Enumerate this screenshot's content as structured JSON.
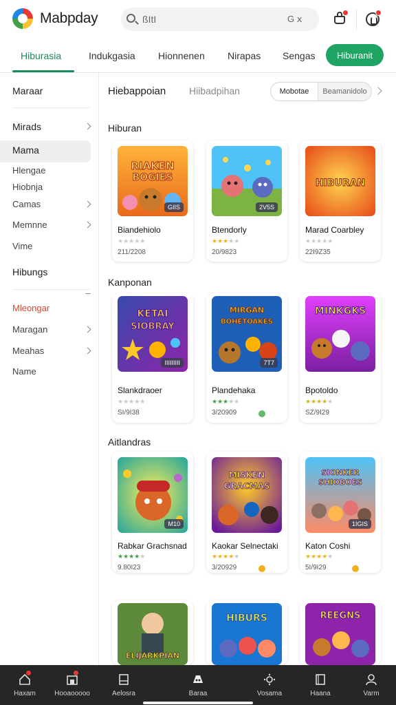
{
  "app": {
    "title": "Mabpday",
    "search_text": "ßItI",
    "search_shortcut": "G ⅹ"
  },
  "tabs": {
    "items": [
      "Hiburasia",
      "Indukgasia",
      "Hionnenen",
      "Nirapas",
      "Sengas"
    ],
    "active": "Hiburasia",
    "cta": "Hiburanit"
  },
  "sidebar": {
    "items": [
      "Maraar",
      "Mirads",
      "Mama",
      "Hlengae",
      "Hiobnja",
      "Camas",
      "Memnne",
      "Vime",
      "Hibungs",
      "Mleongar",
      "Maragan",
      "Meahas",
      "Name"
    ]
  },
  "main": {
    "title": "Hiebappoian",
    "subtitle": "Hiibadpihan",
    "segment_a": "Mobotae",
    "segment_b": "Beamanidolo"
  },
  "sections": [
    {
      "title": "Hiburan",
      "cards": [
        {
          "thumb_text": "RIAKEN BOGIES",
          "tag": "GIIS",
          "name": "Biandehiolo",
          "meta": "211/2208",
          "stars_color": "#c9c9c9"
        },
        {
          "thumb_text": "",
          "tag": "2V5S",
          "name": "Btendorly",
          "meta": "20/9823",
          "stars_color": "#f2b01e"
        },
        {
          "thumb_text": "HIBURAN",
          "tag": "",
          "name": "Marad Coarbley",
          "meta": "22I9Z35",
          "stars_color": "#c9c9c9"
        }
      ]
    },
    {
      "title": "Kanponan",
      "cards": [
        {
          "thumb_text": "KETAI SIOBRAY",
          "tag": "IIIIIIIII",
          "name": "Slankdraoer",
          "meta": "SI/9I38",
          "stars_color": "#c9c9c9"
        },
        {
          "thumb_text": "MIRGAN BOHETOAKES",
          "tag": "7T7",
          "name": "Plandehaka",
          "meta": "3/20909",
          "stars_color": "#43a047"
        },
        {
          "thumb_text": "MINKGKS",
          "tag": "",
          "name": "Bpotoldo",
          "meta": "SZ/9I29",
          "stars_color": "#d6b21c"
        }
      ]
    },
    {
      "title": "Aitlandras",
      "cards": [
        {
          "thumb_text": "",
          "tag": "M10",
          "name": "Rabkar Grachsnad",
          "meta": "9.80I23",
          "stars_color": "#43a047"
        },
        {
          "thumb_text": "MISKEN GRACMAS",
          "tag": "",
          "name": "Kaokar Selnectaki",
          "meta": "3/20929",
          "stars_color": "#f2b01e"
        },
        {
          "thumb_text": "SIONKER SHIOBOES",
          "tag": "1IGIS",
          "name": "Katon Coshi",
          "meta": "5I/9I29",
          "stars_color": "#f2b01e"
        }
      ]
    },
    {
      "title": "",
      "cards": [
        {
          "thumb_text": "ELIJARKPIAN",
          "tag": "",
          "name": "",
          "meta": "",
          "stars_color": ""
        },
        {
          "thumb_text": "HIBURS",
          "tag": "",
          "name": "",
          "meta": "",
          "stars_color": ""
        },
        {
          "thumb_text": "REEGNS",
          "tag": "",
          "name": "",
          "meta": "",
          "stars_color": ""
        }
      ]
    }
  ],
  "bottom_nav": {
    "items": [
      "Haxam",
      "Hooaooooo",
      "Aelosra",
      "Baraa",
      "Vosama",
      "Haana",
      "Varm"
    ]
  },
  "colors": {
    "accent": "#1c8a5b",
    "cta": "#1fa463",
    "badge": "#e53935",
    "nav_bg": "#262626"
  },
  "icons": [
    "search-icon",
    "cart-icon",
    "profile-icon",
    "home-icon",
    "store-icon",
    "tablet-icon",
    "game-icon",
    "sun-icon",
    "book-icon",
    "user-icon"
  ]
}
